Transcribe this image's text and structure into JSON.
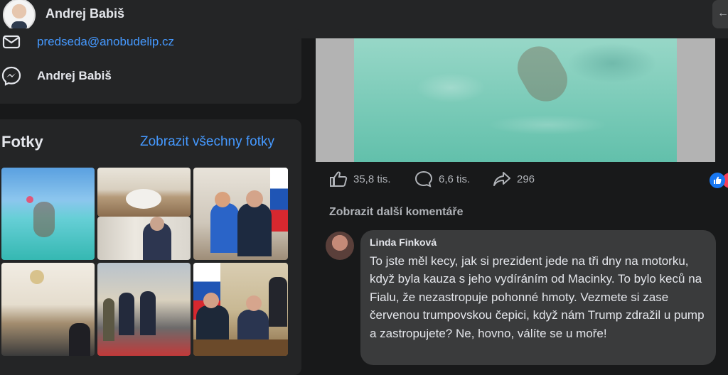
{
  "header": {
    "page_name": "Andrej Babiš",
    "corner_glyph": "←"
  },
  "contact": {
    "email": "predseda@anobudelip.cz",
    "messenger": "Andrej Babiš"
  },
  "photos": {
    "title": "Fotky",
    "see_all": "Zobrazit všechny fotky"
  },
  "post": {
    "likes": "35,8 tis.",
    "comments": "6,6 tis.",
    "shares": "296",
    "more_comments": "Zobrazit další komentáře"
  },
  "comment": {
    "author": "Linda Finková",
    "text": "To jste měl kecy, jak si prezident jede na tři dny na motorku, když byla kauza s jeho vydíráním od Macinky. To bylo keců na Fialu, že nezastropuje pohonné hmoty. Vezmete si zase červenou trumpovskou čepici, když nám Trump zdražil u pump a zastropujete? Ne, hovno, válíte se u moře!"
  },
  "colors": {
    "link": "#4599ff",
    "background": "#18191a",
    "card": "#242526"
  }
}
